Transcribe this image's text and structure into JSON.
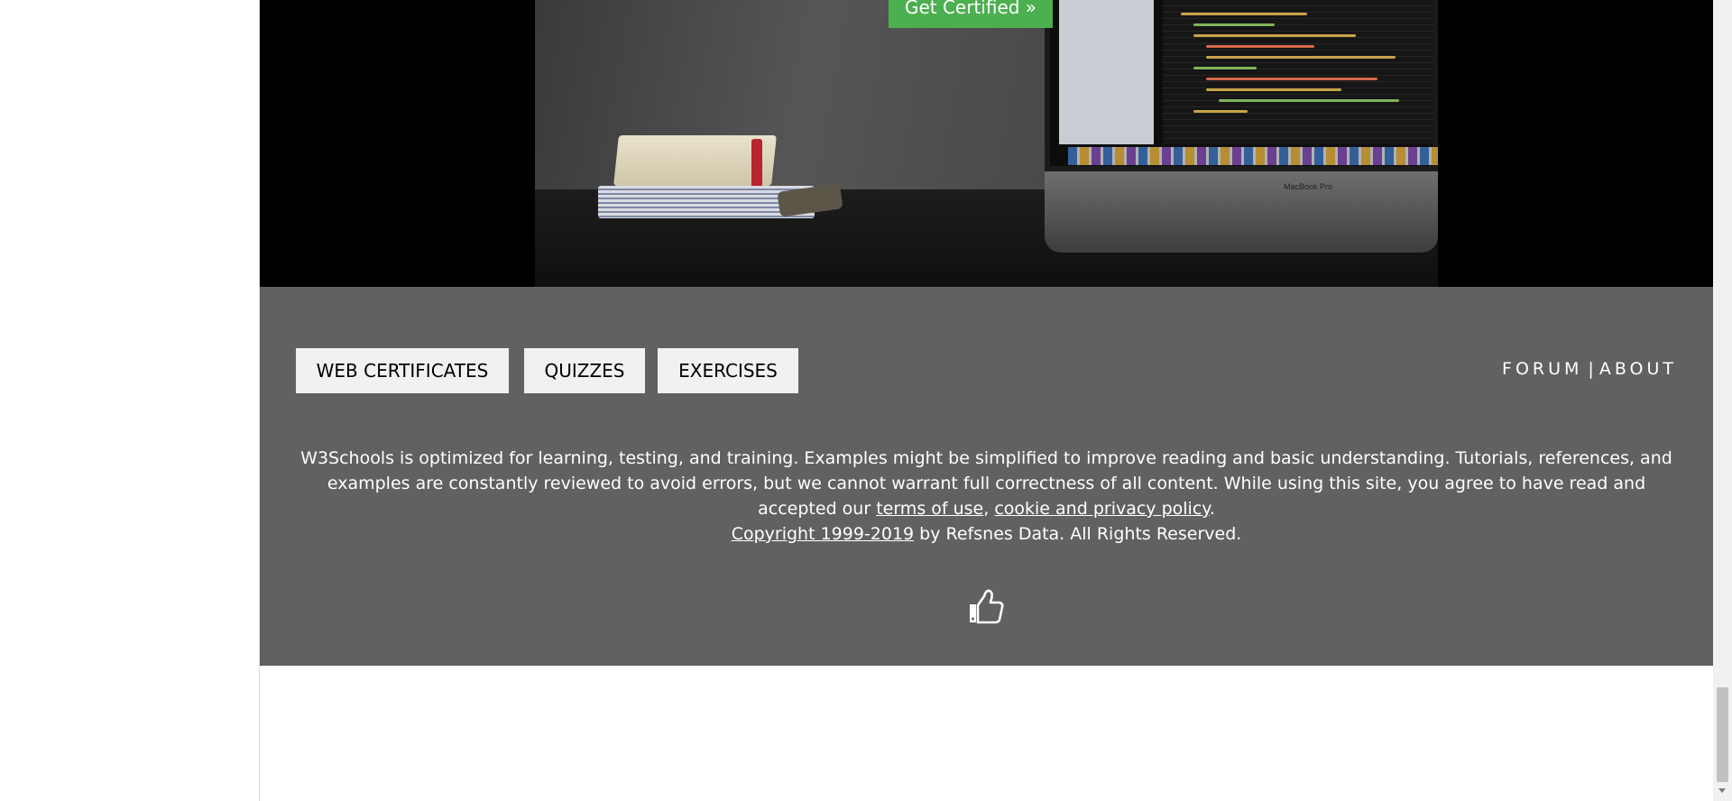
{
  "hero": {
    "cta_label": "Get Certified »",
    "laptop_label": "MacBook Pro"
  },
  "footer": {
    "buttons": [
      {
        "label": "WEB CERTIFICATES"
      },
      {
        "label": "QUIZZES"
      },
      {
        "label": "EXERCISES"
      }
    ],
    "links": {
      "forum": "FORUM",
      "separator": "|",
      "about": "ABOUT"
    },
    "disclaimer": {
      "text_main": "W3Schools is optimized for learning, testing, and training. Examples might be simplified to improve reading and basic understanding. Tutorials, references, and examples are constantly reviewed to avoid errors, but we cannot warrant full correctness of all content. While using this site, you agree to have read and accepted our ",
      "terms_link": "terms of use",
      "comma": ", ",
      "privacy_link": "cookie and privacy policy",
      "period": ".",
      "copyright_link": "Copyright 1999-2019",
      "copyright_rest": " by Refsnes Data. All Rights Reserved."
    },
    "like_icon": "thumbs-up-icon"
  },
  "colors": {
    "footer_bg": "#616161",
    "cta_green": "#4caf50",
    "button_bg": "#f1f1f1",
    "hero_bg": "#000000"
  }
}
